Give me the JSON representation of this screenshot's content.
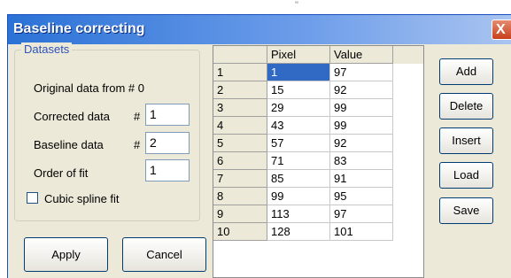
{
  "window": {
    "title": "Baseline correcting",
    "close_symbol": "X",
    "top_mark": "\""
  },
  "datasets": {
    "group_label": "Datasets",
    "original_label": "Original data from # 0",
    "corrected_label": "Corrected data",
    "corrected_value": "1",
    "baseline_label": "Baseline data",
    "baseline_value": "2",
    "hash": "#",
    "order_label": "Order of fit",
    "order_value": "1",
    "cubic_label": "Cubic spline fit",
    "cubic_checked": false
  },
  "buttons": {
    "apply": "Apply",
    "cancel": "Cancel",
    "add": "Add",
    "delete": "Delete",
    "insert": "Insert",
    "load": "Load",
    "save": "Save"
  },
  "table": {
    "columns": [
      "Pixel",
      "Value"
    ],
    "rows": [
      {
        "n": "1",
        "pixel": "1",
        "value": "97"
      },
      {
        "n": "2",
        "pixel": "15",
        "value": "92"
      },
      {
        "n": "3",
        "pixel": "29",
        "value": "99"
      },
      {
        "n": "4",
        "pixel": "43",
        "value": "99"
      },
      {
        "n": "5",
        "pixel": "57",
        "value": "92"
      },
      {
        "n": "6",
        "pixel": "71",
        "value": "83"
      },
      {
        "n": "7",
        "pixel": "85",
        "value": "91"
      },
      {
        "n": "8",
        "pixel": "99",
        "value": "95"
      },
      {
        "n": "9",
        "pixel": "113",
        "value": "97"
      },
      {
        "n": "10",
        "pixel": "128",
        "value": "101"
      }
    ]
  },
  "colors": {
    "titlebar": "#2b72d6",
    "selection": "#316ac5",
    "dialog_bg": "#ece9d8"
  }
}
